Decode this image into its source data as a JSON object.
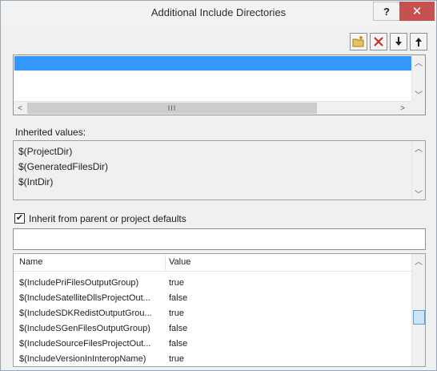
{
  "window": {
    "title": "Additional Include Directories",
    "help_label": "?",
    "close_label": "✕"
  },
  "toolbar": {
    "buttons": [
      {
        "icon": "new-folder-icon",
        "label": ""
      },
      {
        "icon": "delete-icon",
        "label": ""
      },
      {
        "icon": "move-down-icon",
        "label": ""
      },
      {
        "icon": "move-up-icon",
        "label": ""
      }
    ]
  },
  "directory_list": {
    "items": [
      ""
    ],
    "selected_index": 0,
    "hscroll_grip": "III"
  },
  "inherited": {
    "label": "Inherited values:",
    "values": [
      "$(ProjectDir)",
      "$(GeneratedFilesDir)",
      "$(IntDir)"
    ]
  },
  "inherit_checkbox": {
    "label": "Inherit from parent or project defaults",
    "checked": true,
    "check_glyph": "✔"
  },
  "macro_search": {
    "value": ""
  },
  "macros_grid": {
    "columns": [
      "Name",
      "Value"
    ],
    "rows": [
      {
        "name": "$(IncludePriFilesOutputGroup)",
        "value": "true"
      },
      {
        "name": "$(IncludeSatelliteDllsProjectOut...",
        "value": "false"
      },
      {
        "name": "$(IncludeSDKRedistOutputGrou...",
        "value": "true"
      },
      {
        "name": "$(IncludeSGenFilesOutputGroup)",
        "value": "false"
      },
      {
        "name": "$(IncludeSourceFilesProjectOut...",
        "value": "false"
      },
      {
        "name": "$(IncludeVersionInInteropName)",
        "value": "true"
      }
    ]
  },
  "colors": {
    "selection": "#3399ff",
    "close_button": "#c75050",
    "delete_red": "#c42b1c",
    "folder_yellow": "#e8c25a"
  }
}
